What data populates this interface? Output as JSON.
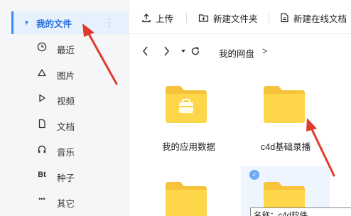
{
  "sidebar": {
    "active": {
      "label": "我的文件"
    },
    "items": [
      {
        "label": "最近",
        "icon": "clock-icon"
      },
      {
        "label": "图片",
        "icon": "image-icon"
      },
      {
        "label": "视频",
        "icon": "play-icon"
      },
      {
        "label": "文档",
        "icon": "document-icon"
      },
      {
        "label": "音乐",
        "icon": "headphones-icon"
      },
      {
        "label": "种子",
        "icon": "bt-icon",
        "glyph": "Bt"
      },
      {
        "label": "其它",
        "icon": "more-icon",
        "glyph": "•••"
      }
    ]
  },
  "toolbar": {
    "upload_label": "上传",
    "new_folder_label": "新建文件夹",
    "new_online_doc_label": "新建在线文档"
  },
  "nav": {
    "breadcrumb": "我的网盘",
    "separator": ">"
  },
  "files": [
    {
      "name": "我的应用数据",
      "type": "app-folder"
    },
    {
      "name": "c4d基础录播",
      "type": "folder"
    },
    {
      "name": "",
      "type": "folder"
    },
    {
      "name": "",
      "type": "folder",
      "selected": true
    }
  ],
  "tooltip": {
    "text": "名称：c4d软件"
  },
  "colors": {
    "accent": "#3b8bf5",
    "folder": "#fdd649",
    "folder_tab": "#f6c33a",
    "annotation": "#e23a2a",
    "sidebar_bg": "#f5f6f8",
    "active_bg": "#e6f1fd"
  }
}
